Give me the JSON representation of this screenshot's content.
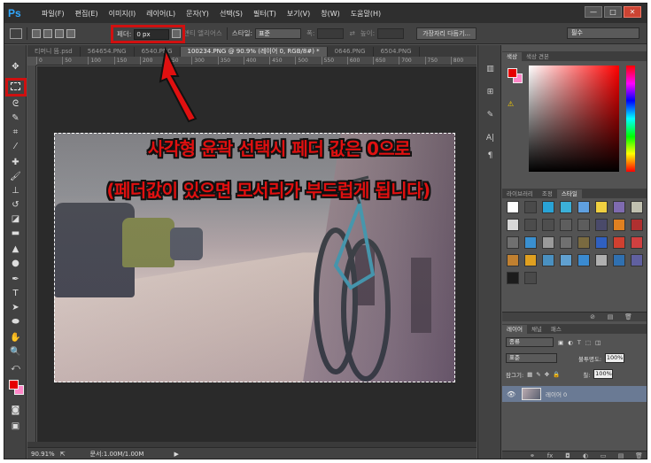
{
  "app": {
    "logo": "Ps"
  },
  "menu": [
    "파일(F)",
    "편집(E)",
    "이미지(I)",
    "레이어(L)",
    "문자(Y)",
    "선택(S)",
    "필터(T)",
    "보기(V)",
    "창(W)",
    "도움말(H)"
  ],
  "window_buttons": [
    "—",
    "□",
    "✕"
  ],
  "options": {
    "feather_label": "페더:",
    "feather_value": "0 px",
    "antialias_label": "앤티 앨리어스",
    "style_label": "스타일:",
    "style_value": "표준",
    "width_label": "폭:",
    "height_label": "높이:",
    "refine_button": "가장자리 다듬기...",
    "workspace": "필수"
  },
  "tabs": [
    "티머니 뜸.psd",
    "564654.PNG",
    "6540.PNG",
    "100234.PNG @ 90.9% (레이어 0, RGB/8#) *",
    "0646.PNG",
    "6504.PNG"
  ],
  "ruler_ticks": [
    "0",
    "50",
    "100",
    "150",
    "200",
    "250",
    "300",
    "350",
    "400",
    "450",
    "500",
    "550",
    "600",
    "650",
    "700",
    "750",
    "800"
  ],
  "overlay": {
    "line1": "사각형 윤곽 선택시 페더 값은 0으로",
    "line2": "(페더값이 있으면 모서리가 부드럽게 됩니다)"
  },
  "status": {
    "zoom": "90.91%",
    "doc": "문서:1.00M/1.00M"
  },
  "color_panel": {
    "tabs": [
      "색상",
      "색상 견본"
    ],
    "fg": "#e60000",
    "bg": "#ff87c8"
  },
  "styles_panel": {
    "tabs": [
      "라이브러리",
      "조정",
      "스타일"
    ],
    "swatch_colors": [
      "#ffffff",
      "#4a4a4a",
      "#29a3d6",
      "#3bb0d8",
      "#5fa0e0",
      "#f0d040",
      "#7f6bb0",
      "#c0c0b0",
      "#d8d8d8",
      "#4c4c4c",
      "#4e4e4e",
      "#5e5e5e",
      "#5d5d5d",
      "#4a4a6a",
      "#e08020",
      "#b03030",
      "#707070",
      "#3a90d0",
      "#9a9a9a",
      "#707070",
      "#7a6a40",
      "#3060c0",
      "#d04030",
      "#d04040",
      "#c08030",
      "#e0a020",
      "#4a90c0",
      "#60a0d0",
      "#3a8ad0",
      "#b0b0b0",
      "#3070b0",
      "#6060a0",
      "#1c1c1c",
      "#4a4a4a"
    ]
  },
  "layers_panel": {
    "tabs": [
      "레이어",
      "채널",
      "패스"
    ],
    "kind_filter": "종류",
    "blend_mode": "표준",
    "opacity_label": "불투명도:",
    "opacity_value": "100%",
    "lock_label": "잠그기:",
    "fill_label": "칠:",
    "fill_value": "100%",
    "layer_name": "레이어 0"
  }
}
